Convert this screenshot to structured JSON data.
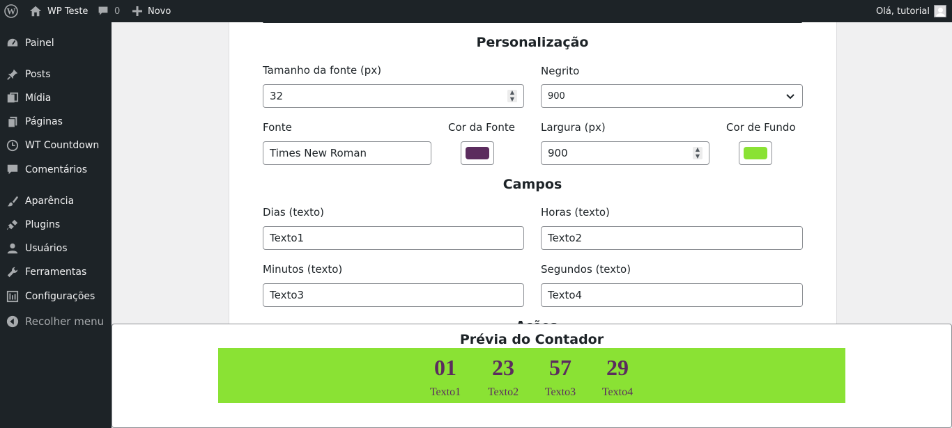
{
  "adminbar": {
    "site_name": "WP Teste",
    "comments_count": "0",
    "new_label": "Novo",
    "greeting": "Olá, tutorial"
  },
  "sidebar": {
    "items": [
      {
        "label": "Painel",
        "icon": "dashboard-icon"
      },
      {
        "label": "Posts",
        "icon": "pin-icon"
      },
      {
        "label": "Mídia",
        "icon": "media-icon"
      },
      {
        "label": "Páginas",
        "icon": "pages-icon"
      },
      {
        "label": "WT Countdown",
        "icon": "clock-icon"
      },
      {
        "label": "Comentários",
        "icon": "comment-icon"
      },
      {
        "label": "Aparência",
        "icon": "brush-icon"
      },
      {
        "label": "Plugins",
        "icon": "plugin-icon"
      },
      {
        "label": "Usuários",
        "icon": "user-icon"
      },
      {
        "label": "Ferramentas",
        "icon": "wrench-icon"
      },
      {
        "label": "Configurações",
        "icon": "settings-icon"
      }
    ],
    "collapse_label": "Recolher menu"
  },
  "personalizacao": {
    "title": "Personalização",
    "font_size_label": "Tamanho da fonte (px)",
    "font_size_value": "32",
    "bold_label": "Negrito",
    "bold_value": "900",
    "font_label": "Fonte",
    "font_value": "Times New Roman",
    "font_color_label": "Cor da Fonte",
    "font_color": "#5b2c5e",
    "width_label": "Largura (px)",
    "width_value": "900",
    "bg_color_label": "Cor de Fundo",
    "bg_color": "#8ae234"
  },
  "campos": {
    "title": "Campos",
    "days_label": "Dias (texto)",
    "days_value": "Texto1",
    "hours_label": "Horas (texto)",
    "hours_value": "Texto2",
    "minutes_label": "Minutos (texto)",
    "minutes_value": "Texto3",
    "seconds_label": "Segundos (texto)",
    "seconds_value": "Texto4"
  },
  "acoes_partial_title": "Ações",
  "preview": {
    "title": "Prévia do Contador",
    "units": [
      {
        "number": "01",
        "label": "Texto1"
      },
      {
        "number": "23",
        "label": "Texto2"
      },
      {
        "number": "57",
        "label": "Texto3"
      },
      {
        "number": "29",
        "label": "Texto4"
      }
    ]
  }
}
